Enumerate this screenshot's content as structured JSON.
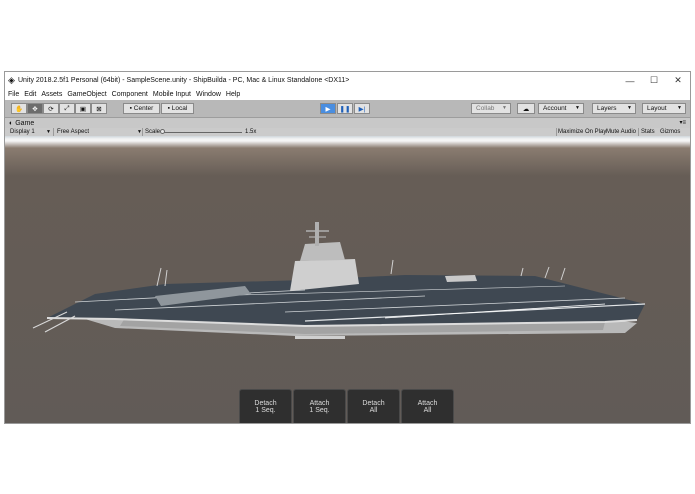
{
  "window": {
    "title": "Unity 2018.2.5f1 Personal (64bit) - SampleScene.unity - ShipBuilda - PC, Mac & Linux Standalone <DX11>"
  },
  "menu": [
    "File",
    "Edit",
    "Assets",
    "GameObject",
    "Component",
    "Mobile Input",
    "Window",
    "Help"
  ],
  "toolbar": {
    "pivot": "Center",
    "space": "Local",
    "collab": "Collab",
    "account": "Account",
    "layers": "Layers",
    "layout": "Layout"
  },
  "game_tab": {
    "label": "Game"
  },
  "game_bar": {
    "display": "Display 1",
    "aspect": "Free Aspect",
    "scale_label": "Scale",
    "scale_value": "1.5x",
    "maximize": "Maximize On Play",
    "mute": "Mute Audio",
    "stats": "Stats",
    "gizmos": "Gizmos"
  },
  "game_buttons": [
    {
      "line1": "Detach",
      "line2": "1 Seq."
    },
    {
      "line1": "Attach",
      "line2": "1 Seq."
    },
    {
      "line1": "Detach",
      "line2": "All"
    },
    {
      "line1": "Attach",
      "line2": "All"
    }
  ],
  "colors": {
    "play_active": "#4a8ee0",
    "deck": "#3f4852",
    "hull": "#c9c9c9"
  },
  "icons": [
    "unity-logo-icon",
    "minimize-icon",
    "maximize-icon",
    "close-icon",
    "hand-tool-icon",
    "move-tool-icon",
    "rotate-tool-icon",
    "scale-tool-icon",
    "rect-tool-icon",
    "transform-tool-icon",
    "play-icon",
    "pause-icon",
    "step-icon",
    "cloud-icon"
  ]
}
